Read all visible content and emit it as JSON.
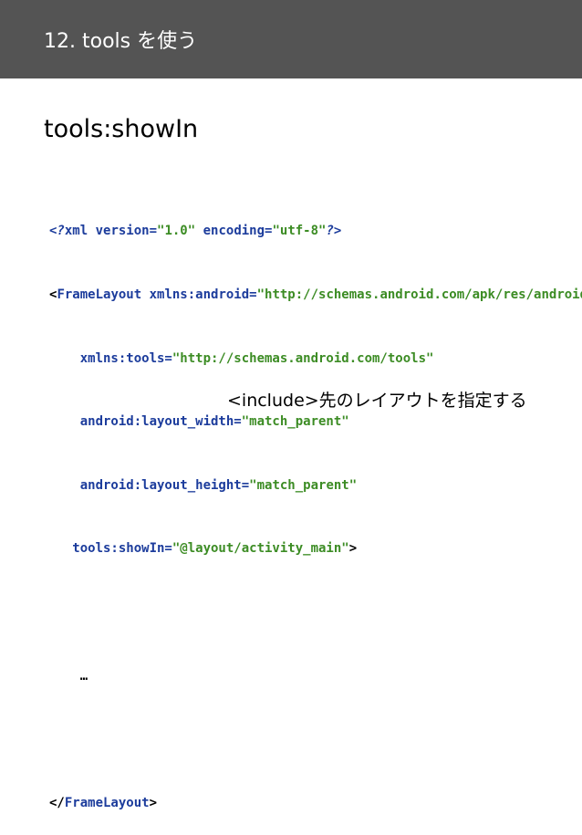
{
  "header": {
    "title": "12. tools を使う"
  },
  "heading": "tools:showIn",
  "code": {
    "l1": {
      "p1": "<?",
      "t1": "xml",
      "a1": " version=",
      "v1": "\"1.0\"",
      "a2": " encoding=",
      "v2": "\"utf-8\"",
      "p2": "?>"
    },
    "l2": {
      "p1": "<",
      "t1": "FrameLayout",
      "a1": " xmlns:android=",
      "v1": "\"http://schemas.android.com/apk/res/android\""
    },
    "l3": {
      "a1": "    xmlns:tools=",
      "v1": "\"http://schemas.android.com/tools\""
    },
    "l4": {
      "a1": "    android:layout_width=",
      "v1": "\"match_parent\""
    },
    "l5": {
      "a1": "    android:layout_height=",
      "v1": "\"match_parent\""
    },
    "l6": {
      "a1": "   tools:showIn=",
      "v1": "\"@layout/activity_main\"",
      "p1": ">"
    },
    "l7": "",
    "l8": "    …",
    "l9": "",
    "l10": {
      "p1": "</",
      "t1": "FrameLayout",
      "p2": ">"
    }
  },
  "note": "<include>先のレイアウトを指定する",
  "colors": {
    "header_bg": "#545454",
    "keyword": "#1c3c9c",
    "string": "#3c8c24"
  }
}
